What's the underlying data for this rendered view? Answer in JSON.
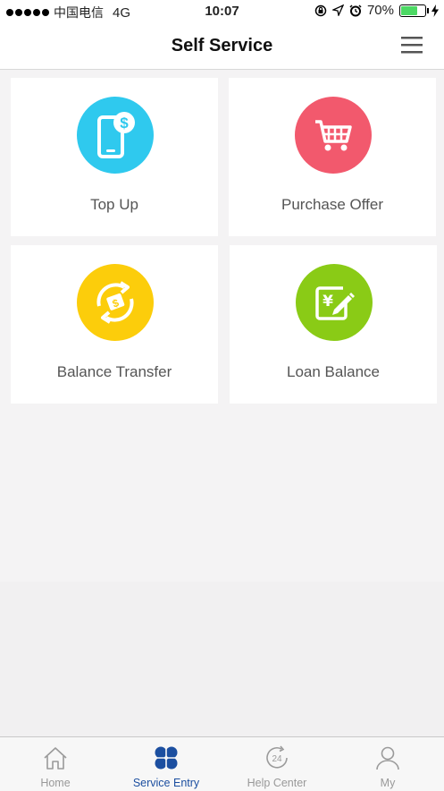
{
  "status_bar": {
    "carrier": "中国电信",
    "network": "4G",
    "time": "10:07",
    "battery": "70%",
    "battery_level": 0.7
  },
  "header": {
    "title": "Self Service",
    "menu_icon": "hamburger-menu-icon"
  },
  "services": [
    {
      "label": "Top Up",
      "icon": "phone-dollar-icon",
      "color": "#2fc9ee"
    },
    {
      "label": "Purchase Offer",
      "icon": "shopping-cart-icon",
      "color": "#f2596d"
    },
    {
      "label": "Balance Transfer",
      "icon": "money-transfer-icon",
      "color": "#fccd0b"
    },
    {
      "label": "Loan Balance",
      "icon": "yuan-edit-icon",
      "color": "#8acb16"
    }
  ],
  "tab_bar": {
    "active": "Service Entry",
    "active_color": "#1c4fa0",
    "tabs": [
      {
        "label": "Home",
        "icon": "home-icon"
      },
      {
        "label": "Service Entry",
        "icon": "clover-grid-icon"
      },
      {
        "label": "Help Center",
        "icon": "24h-clock-icon",
        "icon_text": "24"
      },
      {
        "label": "My",
        "icon": "user-icon"
      }
    ]
  }
}
